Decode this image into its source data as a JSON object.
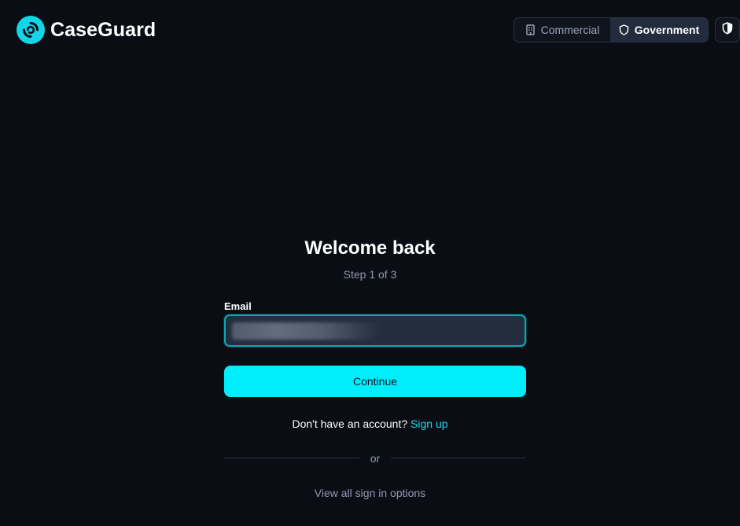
{
  "header": {
    "brand": "CaseGuard",
    "segments": [
      {
        "label": "Commercial",
        "icon": "building-icon",
        "active": false
      },
      {
        "label": "Government",
        "icon": "shield-outline-icon",
        "active": true
      }
    ],
    "shield_button_icon": "shield-filled-icon"
  },
  "form": {
    "title": "Welcome back",
    "step": "Step 1 of 3",
    "email_label": "Email",
    "continue_label": "Continue",
    "signup_prompt": "Don't have an account?",
    "signup_link": "Sign up",
    "divider_text": "or",
    "options_link": "View all sign in options"
  },
  "colors": {
    "background": "#0a0d14",
    "accent": "#00eefc",
    "link": "#1fdcef",
    "input_bg": "#232d3d",
    "input_border": "#0fa6b4"
  }
}
